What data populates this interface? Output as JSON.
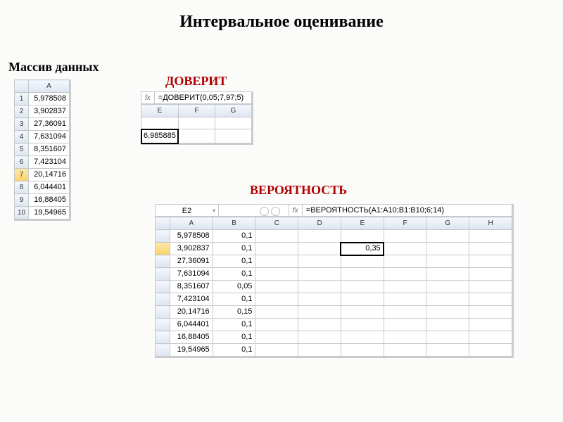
{
  "page": {
    "title": "Интервальное оценивание",
    "subtitle": "Массив данных",
    "label_doverit": "ДОВЕРИТ",
    "label_veroyatnost": "ВЕРОЯТНОСТЬ"
  },
  "tableA": {
    "col": "A",
    "rows": [
      "5,978508",
      "3,902837",
      "27,36091",
      "7,631094",
      "8,351607",
      "7,423104",
      "20,14716",
      "6,044401",
      "16,88405",
      "19,54965"
    ],
    "rownums": [
      "1",
      "2",
      "3",
      "4",
      "5",
      "6",
      "7",
      "8",
      "9",
      "10"
    ],
    "selected_row_index": 6
  },
  "doverit": {
    "fx": "fx",
    "formula": "=ДОВЕРИТ(0,05;7,97;5)",
    "cols": [
      "E",
      "F",
      "G"
    ],
    "result": "6,985885"
  },
  "veroyatnost": {
    "namebox": "E2",
    "fx": "fx",
    "formula": "=ВЕРОЯТНОСТЬ(A1:A10;B1:B10;6;14)",
    "cols": [
      "A",
      "B",
      "C",
      "D",
      "E",
      "F",
      "G",
      "H"
    ],
    "result": "0,35",
    "rows": [
      {
        "a": "5,978508",
        "b": "0,1"
      },
      {
        "a": "3,902837",
        "b": "0,1"
      },
      {
        "a": "27,36091",
        "b": "0,1"
      },
      {
        "a": "7,631094",
        "b": "0,1"
      },
      {
        "a": "8,351607",
        "b": "0,05"
      },
      {
        "a": "7,423104",
        "b": "0,1"
      },
      {
        "a": "20,14716",
        "b": "0,15"
      },
      {
        "a": "6,044401",
        "b": "0,1"
      },
      {
        "a": "16,88405",
        "b": "0,1"
      },
      {
        "a": "19,54965",
        "b": "0,1"
      }
    ]
  }
}
